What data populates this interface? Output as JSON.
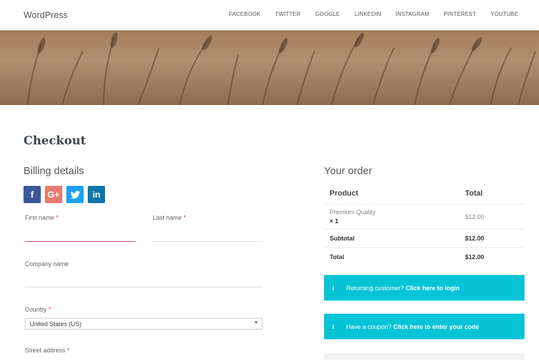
{
  "header": {
    "brand": "WordPress",
    "nav": [
      "FACEBOOK",
      "TWITTER",
      "GOOGLE",
      "LINKEDIN",
      "INSTAGRAM",
      "PINTEREST",
      "YOUTUBE"
    ]
  },
  "page": {
    "title": "Checkout"
  },
  "billing": {
    "title": "Billing details",
    "first_name_label": "First name",
    "last_name_label": "Last name",
    "company_label": "Company name",
    "country_label": "Country",
    "country_value": "United States (US)",
    "street_label": "Street address",
    "required_mark": "*"
  },
  "social_icons": [
    "facebook-icon",
    "google-plus-icon",
    "twitter-icon",
    "linkedin-icon"
  ],
  "order": {
    "title": "Your order",
    "col_product": "Product",
    "col_total": "Total",
    "item_name": "Premium Quality",
    "item_qty": "× 1",
    "item_total": "$12.00",
    "subtotal_label": "Subtotal",
    "subtotal_value": "$12.00",
    "total_label": "Total",
    "total_value": "$12.00"
  },
  "notices": {
    "login_text": "Returning customer?",
    "login_link": "Click here to login",
    "coupon_text": "Have a coupon?",
    "coupon_link": "Click here to enter your code",
    "info_glyph": "i"
  },
  "colors": {
    "accent": "#06c3d6",
    "required": "#e2401c",
    "active_field": "#e0437a"
  }
}
